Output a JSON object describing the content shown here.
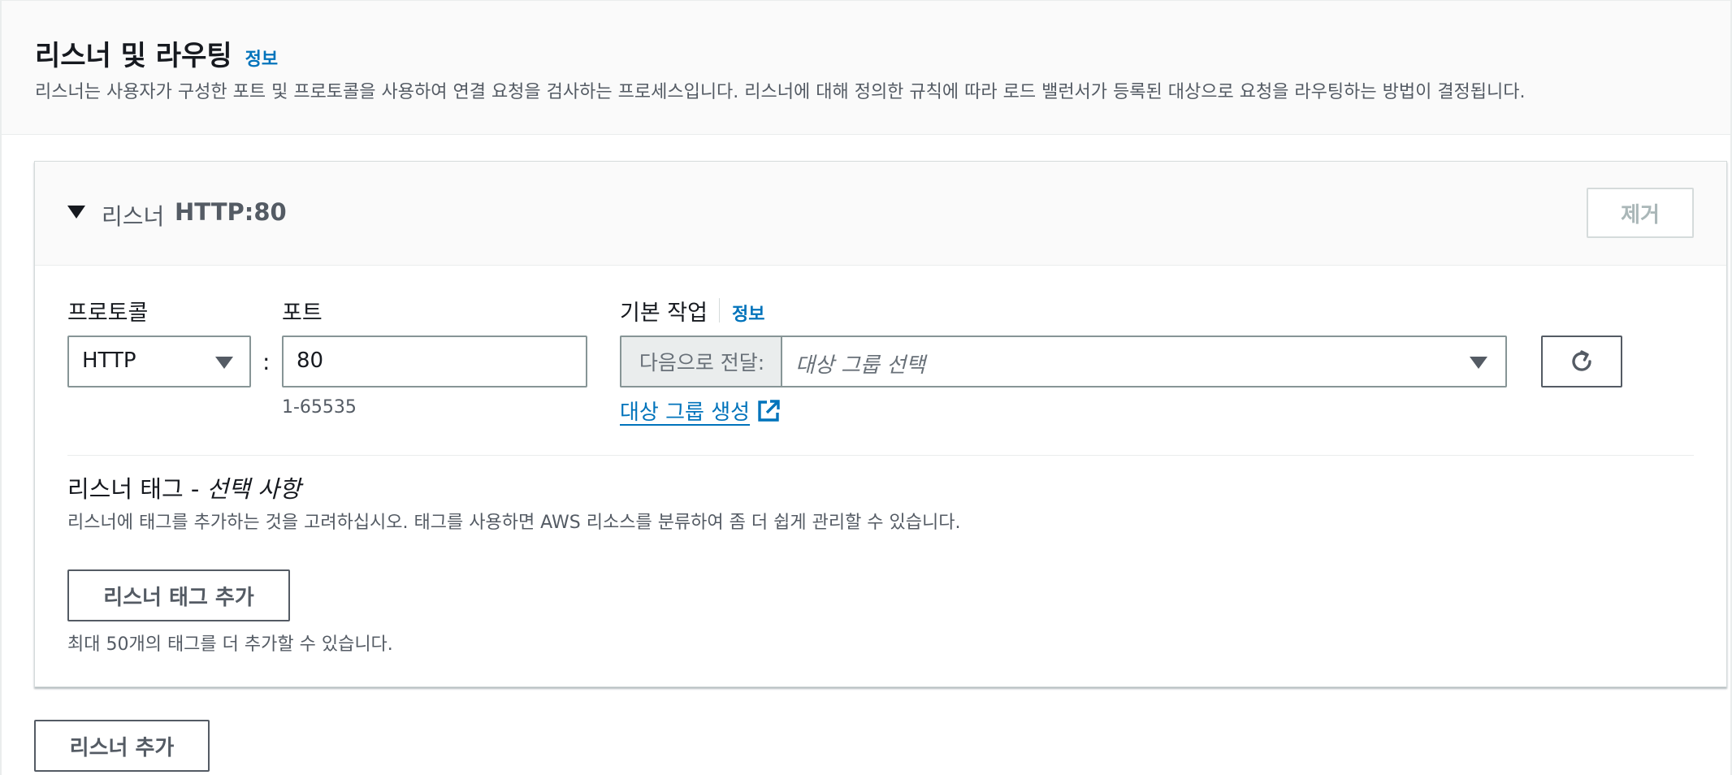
{
  "header": {
    "title": "리스너 및 라우팅",
    "info_label": "정보",
    "description": "리스너는 사용자가 구성한 포트 및 프로토콜을 사용하여 연결 요청을 검사하는 프로세스입니다. 리스너에 대해 정의한 규칙에 따라 로드 밸런서가 등록된 대상으로 요청을 라우팅하는 방법이 결정됩니다."
  },
  "listener": {
    "label": "리스너",
    "name": "HTTP:80",
    "remove_label": "제거",
    "protocol": {
      "label": "프로토콜",
      "value": "HTTP"
    },
    "port_separator": ":",
    "port": {
      "label": "포트",
      "value": "80",
      "hint": "1-65535"
    },
    "default_action": {
      "label": "기본 작업",
      "info_label": "정보",
      "prefix": "다음으로 전달:",
      "placeholder": "대상 그룹 선택",
      "create_link": "대상 그룹 생성"
    },
    "tags": {
      "title": "리스너 태그 - ",
      "title_optional": "선택 사항",
      "description": "리스너에 태그를 추가하는 것을 고려하십시오. 태그를 사용하면 AWS 리소스를 분류하여 좀 더 쉽게 관리할 수 있습니다.",
      "add_label": "리스너 태그 추가",
      "limit_hint": "최대 50개의 태그를 더 추가할 수 있습니다."
    }
  },
  "add_listener_label": "리스너 추가",
  "icons": {
    "collapse": "caret-down-icon",
    "refresh": "refresh-icon",
    "external": "external-link-icon",
    "dropdown": "chevron-down-icon"
  },
  "colors": {
    "link": "#0073bb",
    "header_bg": "#fafafa",
    "border": "#879596",
    "text": "#16191f",
    "muted": "#545b64"
  }
}
